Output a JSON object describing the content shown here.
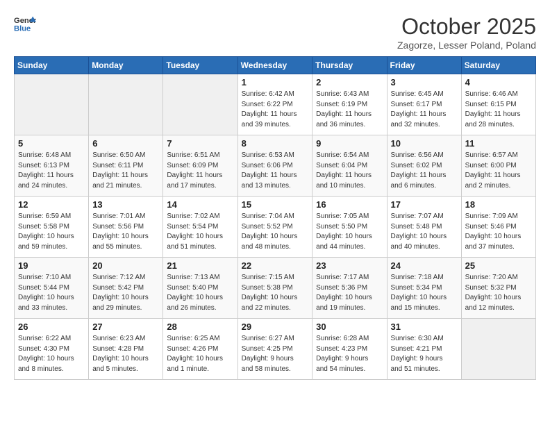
{
  "header": {
    "logo": {
      "line1": "General",
      "line2": "Blue"
    },
    "title": "October 2025",
    "subtitle": "Zagorze, Lesser Poland, Poland"
  },
  "weekdays": [
    "Sunday",
    "Monday",
    "Tuesday",
    "Wednesday",
    "Thursday",
    "Friday",
    "Saturday"
  ],
  "weeks": [
    [
      {
        "day": "",
        "info": ""
      },
      {
        "day": "",
        "info": ""
      },
      {
        "day": "",
        "info": ""
      },
      {
        "day": "1",
        "info": "Sunrise: 6:42 AM\nSunset: 6:22 PM\nDaylight: 11 hours\nand 39 minutes."
      },
      {
        "day": "2",
        "info": "Sunrise: 6:43 AM\nSunset: 6:19 PM\nDaylight: 11 hours\nand 36 minutes."
      },
      {
        "day": "3",
        "info": "Sunrise: 6:45 AM\nSunset: 6:17 PM\nDaylight: 11 hours\nand 32 minutes."
      },
      {
        "day": "4",
        "info": "Sunrise: 6:46 AM\nSunset: 6:15 PM\nDaylight: 11 hours\nand 28 minutes."
      }
    ],
    [
      {
        "day": "5",
        "info": "Sunrise: 6:48 AM\nSunset: 6:13 PM\nDaylight: 11 hours\nand 24 minutes."
      },
      {
        "day": "6",
        "info": "Sunrise: 6:50 AM\nSunset: 6:11 PM\nDaylight: 11 hours\nand 21 minutes."
      },
      {
        "day": "7",
        "info": "Sunrise: 6:51 AM\nSunset: 6:09 PM\nDaylight: 11 hours\nand 17 minutes."
      },
      {
        "day": "8",
        "info": "Sunrise: 6:53 AM\nSunset: 6:06 PM\nDaylight: 11 hours\nand 13 minutes."
      },
      {
        "day": "9",
        "info": "Sunrise: 6:54 AM\nSunset: 6:04 PM\nDaylight: 11 hours\nand 10 minutes."
      },
      {
        "day": "10",
        "info": "Sunrise: 6:56 AM\nSunset: 6:02 PM\nDaylight: 11 hours\nand 6 minutes."
      },
      {
        "day": "11",
        "info": "Sunrise: 6:57 AM\nSunset: 6:00 PM\nDaylight: 11 hours\nand 2 minutes."
      }
    ],
    [
      {
        "day": "12",
        "info": "Sunrise: 6:59 AM\nSunset: 5:58 PM\nDaylight: 10 hours\nand 59 minutes."
      },
      {
        "day": "13",
        "info": "Sunrise: 7:01 AM\nSunset: 5:56 PM\nDaylight: 10 hours\nand 55 minutes."
      },
      {
        "day": "14",
        "info": "Sunrise: 7:02 AM\nSunset: 5:54 PM\nDaylight: 10 hours\nand 51 minutes."
      },
      {
        "day": "15",
        "info": "Sunrise: 7:04 AM\nSunset: 5:52 PM\nDaylight: 10 hours\nand 48 minutes."
      },
      {
        "day": "16",
        "info": "Sunrise: 7:05 AM\nSunset: 5:50 PM\nDaylight: 10 hours\nand 44 minutes."
      },
      {
        "day": "17",
        "info": "Sunrise: 7:07 AM\nSunset: 5:48 PM\nDaylight: 10 hours\nand 40 minutes."
      },
      {
        "day": "18",
        "info": "Sunrise: 7:09 AM\nSunset: 5:46 PM\nDaylight: 10 hours\nand 37 minutes."
      }
    ],
    [
      {
        "day": "19",
        "info": "Sunrise: 7:10 AM\nSunset: 5:44 PM\nDaylight: 10 hours\nand 33 minutes."
      },
      {
        "day": "20",
        "info": "Sunrise: 7:12 AM\nSunset: 5:42 PM\nDaylight: 10 hours\nand 29 minutes."
      },
      {
        "day": "21",
        "info": "Sunrise: 7:13 AM\nSunset: 5:40 PM\nDaylight: 10 hours\nand 26 minutes."
      },
      {
        "day": "22",
        "info": "Sunrise: 7:15 AM\nSunset: 5:38 PM\nDaylight: 10 hours\nand 22 minutes."
      },
      {
        "day": "23",
        "info": "Sunrise: 7:17 AM\nSunset: 5:36 PM\nDaylight: 10 hours\nand 19 minutes."
      },
      {
        "day": "24",
        "info": "Sunrise: 7:18 AM\nSunset: 5:34 PM\nDaylight: 10 hours\nand 15 minutes."
      },
      {
        "day": "25",
        "info": "Sunrise: 7:20 AM\nSunset: 5:32 PM\nDaylight: 10 hours\nand 12 minutes."
      }
    ],
    [
      {
        "day": "26",
        "info": "Sunrise: 6:22 AM\nSunset: 4:30 PM\nDaylight: 10 hours\nand 8 minutes."
      },
      {
        "day": "27",
        "info": "Sunrise: 6:23 AM\nSunset: 4:28 PM\nDaylight: 10 hours\nand 5 minutes."
      },
      {
        "day": "28",
        "info": "Sunrise: 6:25 AM\nSunset: 4:26 PM\nDaylight: 10 hours\nand 1 minute."
      },
      {
        "day": "29",
        "info": "Sunrise: 6:27 AM\nSunset: 4:25 PM\nDaylight: 9 hours\nand 58 minutes."
      },
      {
        "day": "30",
        "info": "Sunrise: 6:28 AM\nSunset: 4:23 PM\nDaylight: 9 hours\nand 54 minutes."
      },
      {
        "day": "31",
        "info": "Sunrise: 6:30 AM\nSunset: 4:21 PM\nDaylight: 9 hours\nand 51 minutes."
      },
      {
        "day": "",
        "info": ""
      }
    ]
  ]
}
